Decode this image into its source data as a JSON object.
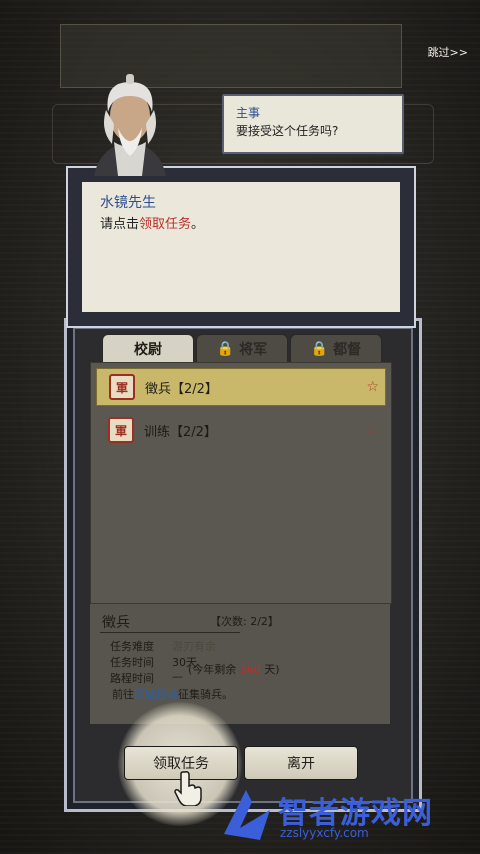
{
  "header": {
    "skip_label": "跳过>>"
  },
  "bubble": {
    "speaker": "主事",
    "question": "要接受这个任务吗?"
  },
  "dialog": {
    "speaker": "水镜先生",
    "text_prefix": "请点击",
    "text_highlight": "领取任务",
    "text_suffix": "。"
  },
  "tabs": [
    {
      "label": "校尉"
    },
    {
      "label": "将军"
    },
    {
      "label": "都督"
    }
  ],
  "tasks": [
    {
      "seal": "軍",
      "label": "徵兵【2/2】"
    },
    {
      "seal": "軍",
      "label": "训练【2/2】"
    }
  ],
  "detail": {
    "title": "徵兵",
    "count": "【次数: 2/2】",
    "rows": [
      {
        "label": "任务难度",
        "value": "游刃有余"
      },
      {
        "label": "任务时间",
        "value": "30天"
      },
      {
        "label": "路程时间",
        "value": "—"
      }
    ],
    "remain_prefix": "(今年剩余",
    "remain_value": "360",
    "remain_suffix": "天)",
    "goto_prefix": "前往",
    "goto_place": "陈留校场",
    "goto_suffix": "征集骑兵。"
  },
  "buttons": {
    "accept": "领取任务",
    "leave": "离开"
  },
  "watermark": {
    "title": "智者游戏网",
    "url": "zzslyyxcfy.com"
  },
  "colors": {
    "accent_red": "#b8322a",
    "accent_blue": "#2f4f8f",
    "watermark": "#3b5fd8"
  }
}
